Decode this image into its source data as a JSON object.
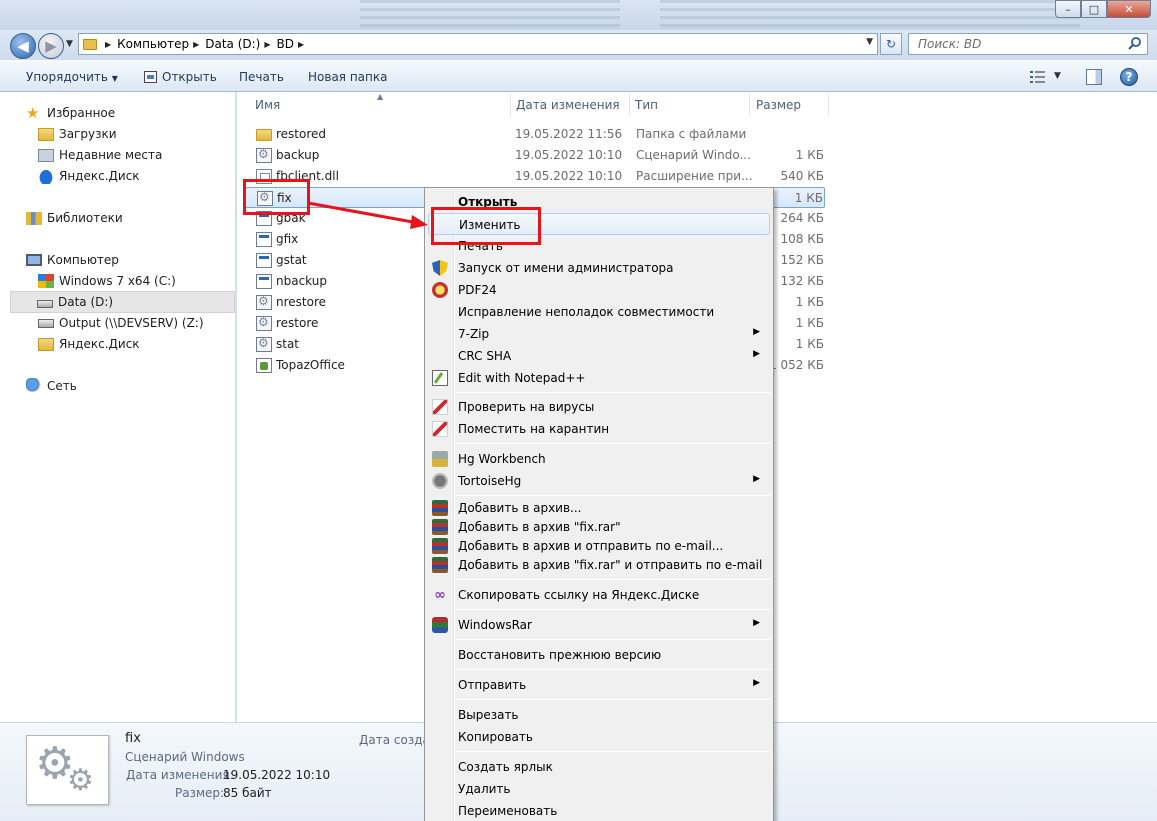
{
  "window": {
    "controls": {
      "minimize": "–",
      "maximize": "□",
      "close": "✕"
    }
  },
  "navbar": {
    "breadcrumbs": [
      "Компьютер",
      "Data (D:)",
      "BD"
    ],
    "search_placeholder": "Поиск: BD"
  },
  "toolbar": {
    "organize": "Упорядочить",
    "open": "Открыть",
    "print": "Печать",
    "new_folder": "Новая папка"
  },
  "sidebar": {
    "favorites": "Избранное",
    "downloads": "Загрузки",
    "recent": "Недавние места",
    "yandex_disk": "Яндекс.Диск",
    "libraries": "Библиотеки",
    "computer": "Компьютер",
    "drive_c": "Windows 7 x64 (C:)",
    "drive_d": "Data (D:)",
    "drive_z": "Output (\\\\DEVSERV) (Z:)",
    "yandex_disk2": "Яндекс.Диск",
    "network": "Сеть"
  },
  "columns": {
    "name": "Имя",
    "date": "Дата изменения",
    "type": "Тип",
    "size": "Размер"
  },
  "files": [
    {
      "name": "restored",
      "date": "19.05.2022 11:56",
      "type": "Папка с файлами",
      "size": "",
      "icon": "folder-icon"
    },
    {
      "name": "backup",
      "date": "19.05.2022 10:10",
      "type": "Сценарий Windo...",
      "size": "1 КБ",
      "icon": "script-icon"
    },
    {
      "name": "fbclient.dll",
      "date": "19.05.2022 10:10",
      "type": "Расширение при...",
      "size": "540 КБ",
      "icon": "dll-icon"
    },
    {
      "name": "fix",
      "date": "",
      "type": "",
      "size": "1 КБ",
      "icon": "script-icon"
    },
    {
      "name": "gbak",
      "date": "",
      "type": "",
      "size": "264 КБ",
      "icon": "exe-icon"
    },
    {
      "name": "gfix",
      "date": "",
      "type": "",
      "size": "108 КБ",
      "icon": "exe-icon"
    },
    {
      "name": "gstat",
      "date": "",
      "type": "",
      "size": "152 КБ",
      "icon": "exe-icon"
    },
    {
      "name": "nbackup",
      "date": "",
      "type": "",
      "size": "132 КБ",
      "icon": "exe-icon"
    },
    {
      "name": "nrestore",
      "date": "",
      "type": "",
      "size": "1 КБ",
      "icon": "script-icon"
    },
    {
      "name": "restore",
      "date": "",
      "type": "",
      "size": "1 КБ",
      "icon": "script-icon"
    },
    {
      "name": "stat",
      "date": "",
      "type": "",
      "size": "1 КБ",
      "icon": "script-icon"
    },
    {
      "name": "TopazOffice",
      "date": "",
      "type": "",
      "size": "11 052 КБ",
      "icon": "topaz-icon"
    }
  ],
  "context_menu": {
    "open": "Открыть",
    "edit": "Изменить",
    "print": "Печать",
    "run_as_admin": "Запуск от имени администратора",
    "pdf24": "PDF24",
    "compat": "Исправление неполадок совместимости",
    "zip7": "7-Zip",
    "crc": "CRC SHA",
    "notepadpp": "Edit with Notepad++",
    "scan": "Проверить на вирусы",
    "quarantine": "Поместить на карантин",
    "hg_workbench": "Hg Workbench",
    "tortoisehg": "TortoiseHg",
    "add_archive": "Добавить в архив...",
    "add_fixrar": "Добавить в архив \"fix.rar\"",
    "add_email": "Добавить в архив и отправить по e-mail...",
    "add_fixrar_email": "Добавить в архив \"fix.rar\" и отправить по e-mail",
    "yandex_link": "Скопировать ссылку на Яндекс.Диске",
    "winrar": "WindowsRar",
    "restore_prev": "Восстановить прежнюю версию",
    "send_to": "Отправить",
    "cut": "Вырезать",
    "copy": "Копировать",
    "shortcut": "Создать ярлык",
    "delete": "Удалить",
    "rename": "Переименовать"
  },
  "details": {
    "name": "fix",
    "type": "Сценарий Windows",
    "modified_label": "Дата изменения:",
    "modified_value": "19.05.2022 10:10",
    "size_label": "Размер:",
    "size_value": "85 байт",
    "created_label": "Дата создан"
  },
  "colors": {
    "annotation": "#e6151c",
    "selection": "#d5e7fb",
    "toolbar_text": "#1e395b"
  }
}
